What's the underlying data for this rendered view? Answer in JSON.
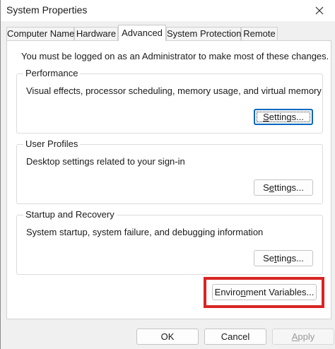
{
  "window": {
    "title": "System Properties"
  },
  "tabs": [
    {
      "label": "Computer Name",
      "active": false
    },
    {
      "label": "Hardware",
      "active": false
    },
    {
      "label": "Advanced",
      "active": true
    },
    {
      "label": "System Protection",
      "active": false
    },
    {
      "label": "Remote",
      "active": false
    }
  ],
  "advanced": {
    "admin_note": "You must be logged on as an Administrator to make most of these changes.",
    "performance": {
      "title": "Performance",
      "description": "Visual effects, processor scheduling, memory usage, and virtual memory",
      "button_pre": "",
      "button_ul": "S",
      "button_post": "ettings..."
    },
    "user_profiles": {
      "title": "User Profiles",
      "description": "Desktop settings related to your sign-in",
      "button_pre": "S",
      "button_ul": "e",
      "button_post": "ttings..."
    },
    "startup_recovery": {
      "title": "Startup and Recovery",
      "description": "System startup, system failure, and debugging information",
      "button_pre": "Se",
      "button_ul": "t",
      "button_post": "tings..."
    },
    "env_button": {
      "pre": "Enviro",
      "ul": "n",
      "post": "ment Variables..."
    }
  },
  "footer": {
    "ok_label": "OK",
    "cancel_label": "Cancel",
    "apply_label": "Apply",
    "apply_enabled": false
  },
  "colors": {
    "highlight": "#d92424",
    "focus_border": "#0067c0"
  }
}
